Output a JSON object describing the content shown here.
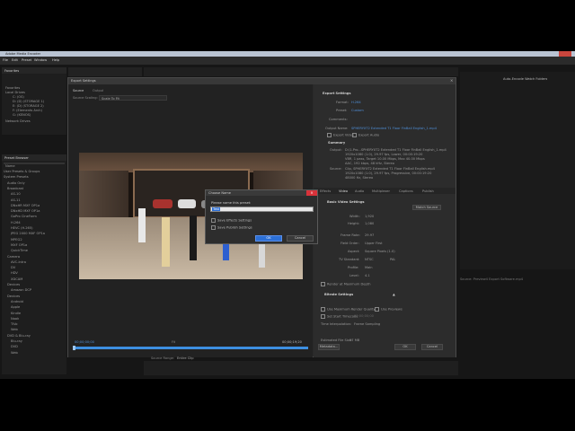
{
  "app": {
    "title": "Adobe Media Encoder",
    "menu": [
      "File",
      "Edit",
      "Preset",
      "Window",
      "Help"
    ]
  },
  "left_top_panel": {
    "tab": "Favorites",
    "tree": [
      "Favorites",
      "Local Drives",
      "C: (OS)",
      "D: (D) (STORAGE 1)",
      "E: (D) (STORAGE 2)",
      "F: (Elements Arch)",
      "G: (KENOS)",
      "Network Drives"
    ]
  },
  "left_bottom_panel": {
    "tab": "Preset Browser",
    "header": "Name",
    "items": [
      "User Presets & Groups",
      "System Presets",
      "Audio Only",
      "Broadcast",
      "AS-10",
      "AS-11",
      "DNxHR MXF OP1a",
      "DNxHD MXF OP1a",
      "GoPro CineForm",
      "H.264",
      "HEVC (H.265)",
      "JPEG 2000 MXF OP1a",
      "MPEG2",
      "MXF OP1a",
      "QuickTime",
      "Camera",
      "AVC-Intra",
      "DV",
      "HDV",
      "XDCAM",
      "Devices",
      "Amazon DCP",
      "Devices",
      "Android",
      "Apple",
      "Kindle",
      "Nook",
      "TiVo",
      "Web",
      "DVD & Blu-ray",
      "Blu-ray",
      "DVD",
      "Web"
    ]
  },
  "right_panel": {
    "title": "Auto-Encode Watch Folders",
    "preset_label": "Source: Preview4 Export Software.mp4"
  },
  "export_dialog": {
    "title": "Export Settings",
    "tabs": [
      "Source",
      "Output"
    ],
    "source_scaling_label": "Source Scaling:",
    "source_scaling_value": "Scale To Fit",
    "export_settings": {
      "heading": "Export Settings",
      "format_label": "Format:",
      "format_value": "H.264",
      "preset_label": "Preset:",
      "preset_value": "Custom",
      "comments_label": "Comments:",
      "output_name_label": "Output Name:",
      "output_name_value": "SPHERYXT2 Extended T1 Floor FinBall English_1.mp4",
      "export_video_label": "Export Video",
      "export_audio_label": "Export Audio"
    },
    "summary": {
      "heading": "Summary",
      "output_label": "Output:",
      "output_lines": [
        "D:\\1-Pro...SPHERYXT2 Extended T1 Floor FinBall English_1.mp4",
        "1920x1080 (1.0), 29.97 fps, Lower, 00:00:19:20",
        "VBR, 1 pass, Target 10.00 Mbps, Max 40.00 Mbps",
        "AAC, 192 kbps, 48 kHz, Stereo"
      ],
      "source_label": "Source:",
      "source_lines": [
        "Clip, SPHERYXT2 Extended T1 Floor FinBall English.mp4",
        "1920x1080 (1.0), 29.97 fps, Progressive, 00:00:19:20",
        "48000 Hz, Stereo"
      ]
    },
    "settings_tabs": [
      "Effects",
      "Video",
      "Audio",
      "Multiplexer",
      "Captions",
      "Publish"
    ],
    "basic_video": {
      "heading": "Basic Video Settings",
      "match_source": "Match Source",
      "width_label": "Width:",
      "width_value": "1,920",
      "height_label": "Height:",
      "height_value": "1,080",
      "frame_rate_label": "Frame Rate:",
      "frame_rate_value": "29.97",
      "field_order_label": "Field Order:",
      "field_order_value": "Upper First",
      "aspect_label": "Aspect:",
      "aspect_value": "Square Pixels (1.0)",
      "tv_standard_label": "TV Standard:",
      "tv_ntsc": "NTSC",
      "tv_pal": "PAL",
      "profile_label": "Profile:",
      "profile_value": "Main",
      "level_label": "Level:",
      "level_value": "4.1",
      "render_max_depth": "Render at Maximum Depth"
    },
    "bitrate": {
      "heading": "Bitrate Settings",
      "use_max_render": "Use Maximum Render Quality",
      "use_previews": "Use Previews",
      "set_start_timecode": "Set Start Timecode",
      "timecode_value": "00;00;00;00",
      "time_interp_label": "Time Interpolation:",
      "time_interp_value": "Frame Sampling",
      "file_size_label": "Estimated File Size:",
      "file_size_value": "27 MB"
    },
    "metadata_btn": "Metadata...",
    "ok_btn": "OK",
    "cancel_btn": "Cancel",
    "timecode_start": "00;00;00;00",
    "timecode_end": "00;00;19;20",
    "fit_label": "Fit",
    "source_range_label": "Source Range:",
    "source_range_value": "Entire Clip"
  },
  "choose_name_dialog": {
    "title": "Choose Name",
    "prompt": "Please name this preset:",
    "name_value": "Test",
    "save_effects": "Save Effects Settings",
    "save_publish": "Save Publish Settings",
    "ok": "OK",
    "cancel": "Cancel"
  },
  "colors": {
    "accent": "#2c6fd6",
    "timeline_blue": "#3d8fe0",
    "close_red": "#d9323a"
  }
}
